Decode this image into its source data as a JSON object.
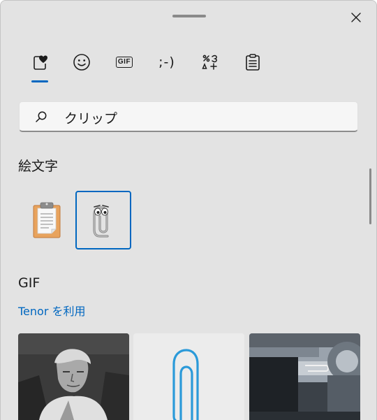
{
  "search": {
    "value": "クリップ",
    "placeholder": ""
  },
  "tabs": [
    {
      "name": "emoji-tab",
      "selected": true
    },
    {
      "name": "smiley-tab"
    },
    {
      "name": "gif-tab",
      "label": "GIF"
    },
    {
      "name": "kaomoji-tab",
      "label": ";-)"
    },
    {
      "name": "symbols-tab"
    },
    {
      "name": "clipboard-history-tab"
    }
  ],
  "sections": {
    "emoji": {
      "title": "絵文字",
      "items": [
        {
          "name": "clipboard-emoji"
        },
        {
          "name": "clippy-emoji",
          "selected": true
        }
      ]
    },
    "gif": {
      "title": "GIF",
      "provider_link": "Tenor を利用",
      "items": [
        {
          "name": "gif-man-grayscale"
        },
        {
          "name": "gif-paperclip-drawing"
        },
        {
          "name": "gif-machine-clip"
        }
      ]
    }
  },
  "colors": {
    "accent": "#0067c0",
    "panel_bg": "#e3e3e3"
  }
}
